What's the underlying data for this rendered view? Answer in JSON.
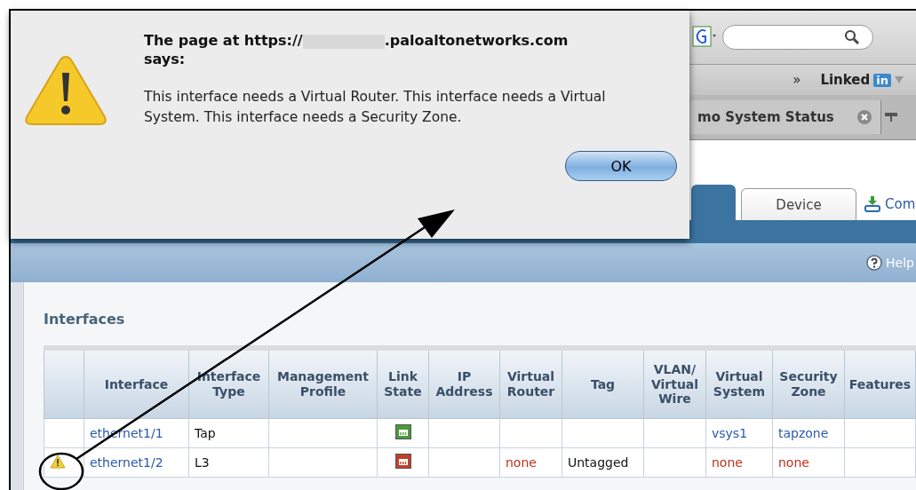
{
  "browser": {
    "overflow": "»",
    "bookmark": "Linked",
    "bookmark_badge": "in",
    "tab_title": "mo System Status"
  },
  "nav": {
    "tabs": [
      {
        "label": "Device",
        "selected": false
      }
    ],
    "commit": "Com",
    "help": "Help"
  },
  "section_title": "Interfaces",
  "table": {
    "columns": [
      "",
      "Interface",
      "Interface Type",
      "Management Profile",
      "Link State",
      "IP Address",
      "Virtual Router",
      "Tag",
      "VLAN/ Virtual Wire",
      "Virtual System",
      "Security Zone",
      "Features"
    ],
    "rows": [
      {
        "cells": [
          {
            "kind": "status",
            "warning": false
          },
          {
            "kind": "link",
            "text": "ethernet1/1"
          },
          {
            "kind": "plain",
            "text": "Tap"
          },
          {
            "kind": "empty"
          },
          {
            "kind": "port",
            "color": "#4a9a3a"
          },
          {
            "kind": "empty"
          },
          {
            "kind": "empty"
          },
          {
            "kind": "empty"
          },
          {
            "kind": "empty"
          },
          {
            "kind": "link",
            "text": "vsys1"
          },
          {
            "kind": "link",
            "text": "tapzone"
          },
          {
            "kind": "empty"
          }
        ]
      },
      {
        "cells": [
          {
            "kind": "status",
            "warning": true
          },
          {
            "kind": "link",
            "text": "ethernet1/2"
          },
          {
            "kind": "plain",
            "text": "L3"
          },
          {
            "kind": "empty"
          },
          {
            "kind": "port",
            "color": "#c0402a"
          },
          {
            "kind": "empty"
          },
          {
            "kind": "error",
            "text": "none"
          },
          {
            "kind": "plain",
            "text": "Untagged"
          },
          {
            "kind": "empty"
          },
          {
            "kind": "error",
            "text": "none"
          },
          {
            "kind": "error",
            "text": "none"
          },
          {
            "kind": "empty"
          }
        ]
      }
    ]
  },
  "dialog": {
    "title_start": "The page at https://",
    "title_end": ".paloaltonetworks.com",
    "title_tail": "says:",
    "message": "This interface needs a Virtual Router. This interface needs a Virtual System. This interface needs a Security Zone.",
    "button": "OK"
  }
}
